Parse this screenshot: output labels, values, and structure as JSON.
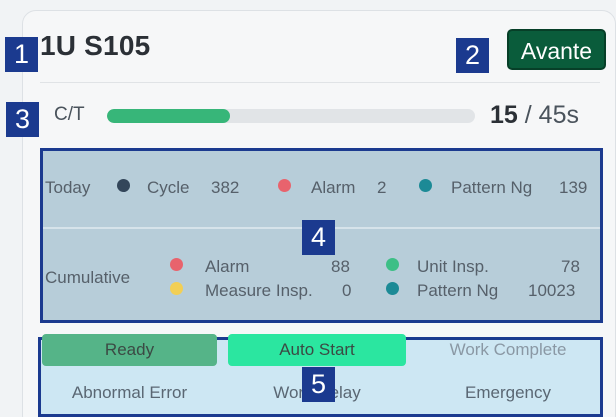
{
  "badges": {
    "b1": "1",
    "b2": "2",
    "b3": "3",
    "b4": "4",
    "b5": "5"
  },
  "device": {
    "name": "1U S105",
    "brand_button": "Avante"
  },
  "cycle_time": {
    "label": "C/T",
    "current": "15",
    "separator": "/",
    "target": "45s",
    "progress": 0.333
  },
  "today": {
    "label": "Today",
    "cycle": {
      "label": "Cycle",
      "value": "382"
    },
    "alarm": {
      "label": "Alarm",
      "value": "2"
    },
    "pattern_ng": {
      "label": "Pattern Ng",
      "value": "139"
    }
  },
  "cumulative": {
    "label": "Cumulative",
    "alarm": {
      "label": "Alarm",
      "value": "88"
    },
    "measure_insp": {
      "label": "Measure Insp.",
      "value": "0"
    },
    "unit_insp": {
      "label": "Unit Insp.",
      "value": "78"
    },
    "pattern_ng": {
      "label": "Pattern Ng",
      "value": "10023"
    }
  },
  "status_buttons": {
    "ready": "Ready",
    "auto_start": "Auto Start",
    "work_complete": "Work Complete",
    "abnormal_error": "Abnormal Error",
    "work_delay": "Work Delay",
    "emergency": "Emergency"
  },
  "colors": {
    "dark_dot": "#33465a",
    "red_dot": "#e8636d",
    "teal_dot": "#1c8a96",
    "green_dot": "#3dbf86",
    "yellow_dot": "#f2cf55",
    "ready_bg": "#55b488",
    "auto_start_bg": "#2be6a0",
    "brand_bg": "#0a5c3b"
  }
}
